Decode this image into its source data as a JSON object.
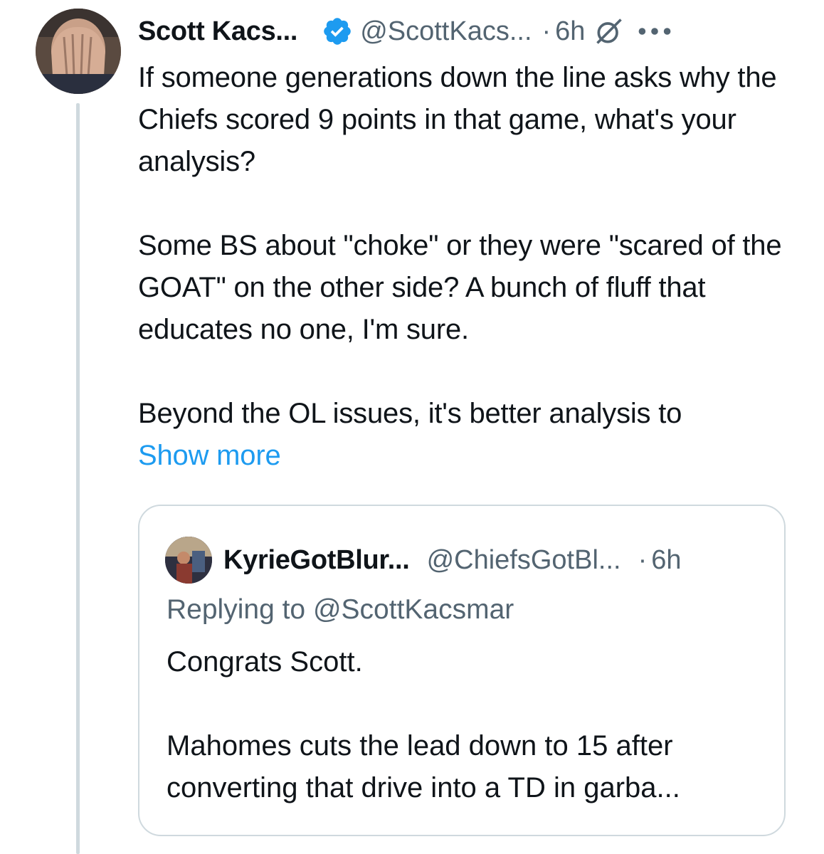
{
  "tweet": {
    "author_name": "Scott Kacs...",
    "author_handle": "@ScottKacs...",
    "separator": "·",
    "time": "6h",
    "paragraphs": [
      "If someone generations down the line asks why the Chiefs scored 9 points in that game, what's your analysis?",
      "Some BS about \"choke\" or they were \"scared of the GOAT\" on the other side? A bunch of fluff that educates no one, I'm sure.",
      "Beyond the OL issues, it's better analysis to"
    ],
    "show_more": "Show more"
  },
  "quoted_tweet": {
    "author_name": "KyrieGotBlur...",
    "author_handle": "@ChiefsGotBl...",
    "separator": "·",
    "time": "6h",
    "replying_to": "Replying to @ScottKacsmar",
    "paragraphs": [
      "Congrats Scott.",
      "Mahomes cuts the lead down to 15 after converting that drive into a TD in garba..."
    ]
  },
  "colors": {
    "accent": "#1d9bf0",
    "text": "#0f1419",
    "muted": "#536471",
    "border": "#cfd9de"
  },
  "icons": {
    "verified": "verified-badge-icon",
    "grok": "grok-icon",
    "more": "more-options-icon"
  }
}
